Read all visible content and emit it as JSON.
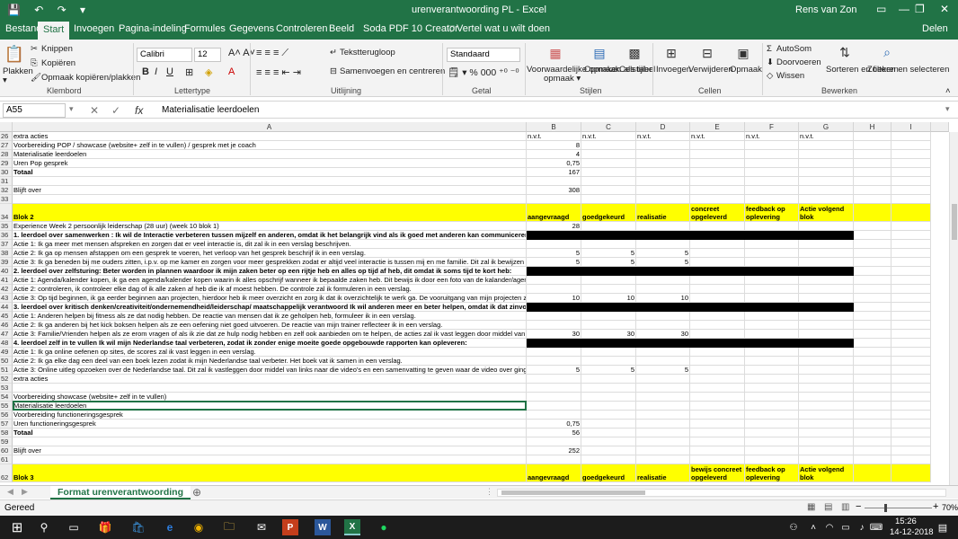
{
  "titlebar": {
    "title": "urenverantwoording PL  -  Excel",
    "user": "Rens van Zon"
  },
  "tabs": [
    "Bestand",
    "Start",
    "Invoegen",
    "Pagina-indeling",
    "Formules",
    "Gegevens",
    "Controleren",
    "Beeld",
    "Soda PDF 10 Creator",
    "Vertel wat u wilt doen",
    "Delen"
  ],
  "ribbon": {
    "paste": "Plakken",
    "cut": "Knippen",
    "copy": "Kopiëren",
    "format_painter": "Opmaak kopiëren/plakken",
    "font_name": "Calibri",
    "font_size": "12",
    "wrap": "Tekstterugloop",
    "merge": "Samenvoegen en centreren",
    "number_format": "Standaard",
    "cond_format": "Voorwaardelijke opmaak",
    "as_table": "Opmaken als tabel",
    "cell_styles": "Celstijlen",
    "insert": "Invoegen",
    "delete": "Verwijderen",
    "format": "Opmaak",
    "autosum": "AutoSom",
    "fill": "Doorvoeren",
    "clear": "Wissen",
    "sort": "Sorteren en filteren",
    "find": "Zoeken en selecteren",
    "groups": [
      "Klembord",
      "Lettertype",
      "Uitlijning",
      "Getal",
      "Stijlen",
      "Cellen",
      "Bewerken"
    ]
  },
  "formula_bar": {
    "name_box": "A55",
    "formula": "Materialisatie leerdoelen"
  },
  "columns": [
    "A",
    "B",
    "C",
    "D",
    "E",
    "F",
    "G",
    "H",
    "I"
  ],
  "rows": [
    {
      "n": "26",
      "cells": [
        "extra acties",
        "n.v.t.",
        "n.v.t.",
        "n.v.t.",
        "n.v.t.",
        "n.v.t.",
        "n.v.t.",
        "",
        ""
      ]
    },
    {
      "n": "27",
      "cells": [
        "Voorbereiding POP /  showcase (website+ zelf in te vullen) / gesprek met je coach",
        "8",
        "",
        "",
        "",
        "",
        "",
        "",
        ""
      ]
    },
    {
      "n": "28",
      "cells": [
        "Materialisatie leerdoelen",
        "4",
        "",
        "",
        "",
        "",
        "",
        "",
        ""
      ]
    },
    {
      "n": "29",
      "cells": [
        "Uren Pop gesprek",
        "0,75",
        "",
        "",
        "",
        "",
        "",
        "",
        ""
      ]
    },
    {
      "n": "30",
      "cells": [
        "Totaal",
        "167",
        "",
        "",
        "",
        "",
        "",
        "",
        ""
      ]
    },
    {
      "n": "31",
      "cells": [
        "",
        "",
        "",
        "",
        "",
        "",
        "",
        "",
        ""
      ]
    },
    {
      "n": "32",
      "cells": [
        "Blijft over",
        "308",
        "",
        "",
        "",
        "",
        "",
        "",
        ""
      ]
    },
    {
      "n": "33",
      "cells": [
        "",
        "",
        "",
        "",
        "",
        "",
        "",
        "",
        ""
      ]
    },
    {
      "n": "34",
      "cells": [
        "Blok 2",
        "aangevraagd",
        "goedgekeurd",
        "realisatie",
        "concreet opgeleverd",
        "feedback op oplevering",
        "Actie volgend blok",
        "",
        ""
      ]
    },
    {
      "n": "35",
      "cells": [
        "Experience Week 2 persoonlijk leiderschap (28 uur) (week 10 blok 1)",
        "28",
        "",
        "",
        "",
        "",
        "",
        "",
        ""
      ]
    },
    {
      "n": "36",
      "cells": [
        "1. leerdoel over samenwerken : Ik wil de Interactie verbeteren tussen mijzelf en anderen, omdat ik het belangrijk vind als ik goed met anderen kan communiceren:",
        "",
        "",
        "",
        "",
        "",
        "",
        "",
        ""
      ]
    },
    {
      "n": "37",
      "cells": [
        "Actie 1: Ik ga meer met mensen afspreken en zorgen dat er veel interactie is, dit zal ik in een verslag beschrijven.",
        "",
        "",
        "",
        "",
        "",
        "",
        "",
        ""
      ]
    },
    {
      "n": "38",
      "cells": [
        "Actie 2: Ik ga op mensen afstappen om een gesprek te voeren, het verloop van het gesprek beschrijf ik in een verslag.",
        "5",
        "5",
        "5",
        "",
        "",
        "",
        "",
        ""
      ]
    },
    {
      "n": "39",
      "cells": [
        "Actie 3: Ik ga beneden bij me ouders zitten, i.p.v. op me kamer en zorgen voor meer gesprekken zodat er altijd veel interactie is tussen mij en me familie. Dit zal ik bewijzen door middel van f",
        "5",
        "5",
        "5",
        "",
        "",
        "",
        "",
        ""
      ]
    },
    {
      "n": "40",
      "cells": [
        "2. leerdoel over zelfsturing: Beter worden in plannen waardoor ik mijn zaken beter op een rijtje heb en alles op tijd af heb, dit omdat ik soms tijd te kort heb:",
        "",
        "",
        "",
        "",
        "",
        "",
        "",
        ""
      ]
    },
    {
      "n": "41",
      "cells": [
        "Actie 1: Agenda/kalender kopen, ik ga een agenda/kalender kopen waarin ik alles opschrijf wanneer ik bepaalde zaken heb. Dit bewijs ik door een foto van de kalander/agenda te maken.",
        "",
        "",
        "",
        "",
        "",
        "",
        "",
        ""
      ]
    },
    {
      "n": "42",
      "cells": [
        "Actie 2: controleren, ik controleer elke dag of ik alle zaken af heb die ik af moest hebben. De controle zal ik formuleren in een verslag.",
        "",
        "",
        "",
        "",
        "",
        "",
        "",
        ""
      ]
    },
    {
      "n": "43",
      "cells": [
        "Actie 3: Op tijd beginnen, ik ga eerder beginnen aan projecten, hierdoor heb ik meer overzicht en zorg ik dat ik overzichtelijk te werk ga. De vooruitgang van mijn projecten zal ik reflecteren",
        "10",
        "10",
        "10",
        "",
        "",
        "",
        "",
        ""
      ]
    },
    {
      "n": "44",
      "cells": [
        "3. leerdoel over kritisch denken/creativiteit/ondernemendheid/leiderschap/ maatschappelijk verantwoord Ik wil anderen meer en beter helpen, omdat ik dat zinvol vind en dat graag doe:",
        "",
        "",
        "",
        "",
        "",
        "",
        "",
        ""
      ]
    },
    {
      "n": "45",
      "cells": [
        "Actie 1: Anderen helpen bij fitness als ze dat nodig hebben. De reactie van mensen dat ik ze geholpen heb, formuleer ik in een verslag.",
        "",
        "",
        "",
        "",
        "",
        "",
        "",
        ""
      ]
    },
    {
      "n": "46",
      "cells": [
        "Actie 2: Ik ga anderen bij het kick boksen helpen als ze een oefening niet goed uitvoeren. De reactie van mijn trainer reflecteer ik in een verslag.",
        "",
        "",
        "",
        "",
        "",
        "",
        "",
        ""
      ]
    },
    {
      "n": "47",
      "cells": [
        "Actie 3: Familie/Vrienden helpen als ze erom vragen of als ik zie dat ze hulp nodig hebben en zelf ook aanbieden om te helpen, de acties zal ik vast leggen door middel van foto's.",
        "30",
        "30",
        "30",
        "",
        "",
        "",
        "",
        ""
      ]
    },
    {
      "n": "48",
      "cells": [
        "4. leerdoel zelf in te vullen  Ik wil mijn Nederlandse taal verbeteren, zodat ik zonder enige moeite goede opgebouwde rapporten kan opleveren:",
        "",
        "",
        "",
        "",
        "",
        "",
        "",
        ""
      ]
    },
    {
      "n": "49",
      "cells": [
        "Actie 1: Ik ga online oefenen op sites, de scores zal ik vast leggen in een verslag.",
        "",
        "",
        "",
        "",
        "",
        "",
        "",
        ""
      ]
    },
    {
      "n": "50",
      "cells": [
        "Actie 2: Ik ga elke dag een deel van een boek lezen zodat ik mijn Nederlandse taal verbeter. Het boek vat ik samen in een verslag.",
        "",
        "",
        "",
        "",
        "",
        "",
        "",
        ""
      ]
    },
    {
      "n": "51",
      "cells": [
        "Actie 3: Online uitleg opzoeken over de Nederlandse taal. Dit zal ik vastleggen door middel van links naar die video's en een samenvatting te geven waar de video over ging.",
        "5",
        "5",
        "5",
        "",
        "",
        "",
        "",
        ""
      ]
    },
    {
      "n": "52",
      "cells": [
        "extra acties",
        "",
        "",
        "",
        "",
        "",
        "",
        "",
        ""
      ]
    },
    {
      "n": "53",
      "cells": [
        "",
        "",
        "",
        "",
        "",
        "",
        "",
        "",
        ""
      ]
    },
    {
      "n": "54",
      "cells": [
        "Voorbereiding showcase (website+ zelf in te vullen)",
        "",
        "",
        "",
        "",
        "",
        "",
        "",
        ""
      ]
    },
    {
      "n": "55",
      "cells": [
        "Materialisatie leerdoelen",
        "",
        "",
        "",
        "",
        "",
        "",
        "",
        ""
      ]
    },
    {
      "n": "56",
      "cells": [
        "Voorbereiding functioneringsgesprek",
        "",
        "",
        "",
        "",
        "",
        "",
        "",
        ""
      ]
    },
    {
      "n": "57",
      "cells": [
        "Uren functioneringsgesprek",
        "0,75",
        "",
        "",
        "",
        "",
        "",
        "",
        ""
      ]
    },
    {
      "n": "58",
      "cells": [
        "Totaal",
        "56",
        "",
        "",
        "",
        "",
        "",
        "",
        ""
      ]
    },
    {
      "n": "59",
      "cells": [
        "",
        "",
        "",
        "",
        "",
        "",
        "",
        "",
        ""
      ]
    },
    {
      "n": "60",
      "cells": [
        "Blijft over",
        "252",
        "",
        "",
        "",
        "",
        "",
        "",
        ""
      ]
    },
    {
      "n": "61",
      "cells": [
        "",
        "",
        "",
        "",
        "",
        "",
        "",
        "",
        ""
      ]
    },
    {
      "n": "62",
      "cells": [
        "Blok 3",
        "aangevraagd",
        "goedgekeurd",
        "realisatie",
        "bewijs concreet opgeleverd",
        "feedback op oplevering",
        "Actie volgend blok",
        "",
        ""
      ]
    }
  ],
  "sheet_tab": "Format urenverantwoording",
  "status": {
    "left": "Gereed",
    "zoom": "70%"
  },
  "taskbar": {
    "time": "15:26",
    "date": "14-12-2018"
  }
}
